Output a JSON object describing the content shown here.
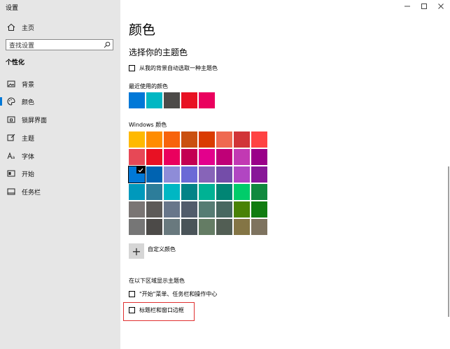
{
  "app": {
    "title": "设置"
  },
  "sidebar": {
    "home_label": "主页",
    "search_placeholder": "查找设置",
    "section_title": "个性化",
    "items": [
      {
        "label": "背景",
        "icon": "image-icon"
      },
      {
        "label": "颜色",
        "icon": "palette-icon",
        "active": true
      },
      {
        "label": "锁屏界面",
        "icon": "lockscreen-icon"
      },
      {
        "label": "主题",
        "icon": "brush-icon"
      },
      {
        "label": "字体",
        "icon": "font-icon"
      },
      {
        "label": "开始",
        "icon": "start-icon"
      },
      {
        "label": "任务栏",
        "icon": "taskbar-icon"
      }
    ]
  },
  "main": {
    "title": "颜色",
    "subtitle": "选择你的主题色",
    "auto_pick_label": "从我的背景自动选取一种主题色",
    "recent_label": "最近使用的颜色",
    "recent_colors": [
      "#0078d7",
      "#00b7c3",
      "#4c4a48",
      "#e81123",
      "#ea005e"
    ],
    "windows_colors_label": "Windows 颜色",
    "windows_colors": [
      [
        "#ffb900",
        "#ff8c00",
        "#f7630c",
        "#ca5010",
        "#da3b01",
        "#ef6950",
        "#d13438",
        "#ff4343"
      ],
      [
        "#e74856",
        "#e81123",
        "#ea005e",
        "#c30052",
        "#e3008c",
        "#bf0077",
        "#c239b3",
        "#9a0089"
      ],
      [
        "#0078d7",
        "#0063b1",
        "#8e8cd8",
        "#6b69d6",
        "#8764b8",
        "#744da9",
        "#b146c2",
        "#881798"
      ],
      [
        "#0099bc",
        "#2d7d9a",
        "#00b7c3",
        "#038387",
        "#00b294",
        "#018574",
        "#00cc6a",
        "#10893e"
      ],
      [
        "#7a7574",
        "#5d5a58",
        "#68768a",
        "#515c6b",
        "#567c73",
        "#486860",
        "#498205",
        "#107c10"
      ],
      [
        "#767676",
        "#4c4a48",
        "#69797e",
        "#4a5459",
        "#647c64",
        "#525e54",
        "#847545",
        "#7e735f"
      ]
    ],
    "selected_color": "#0078d7",
    "custom_color_label": "自定义颜色",
    "show_accent_label": "在以下区域显示主题色",
    "start_taskbar_label": "\"开始\"菜单、任务栏和操作中心",
    "title_bars_label": "标题栏和窗口边框"
  }
}
